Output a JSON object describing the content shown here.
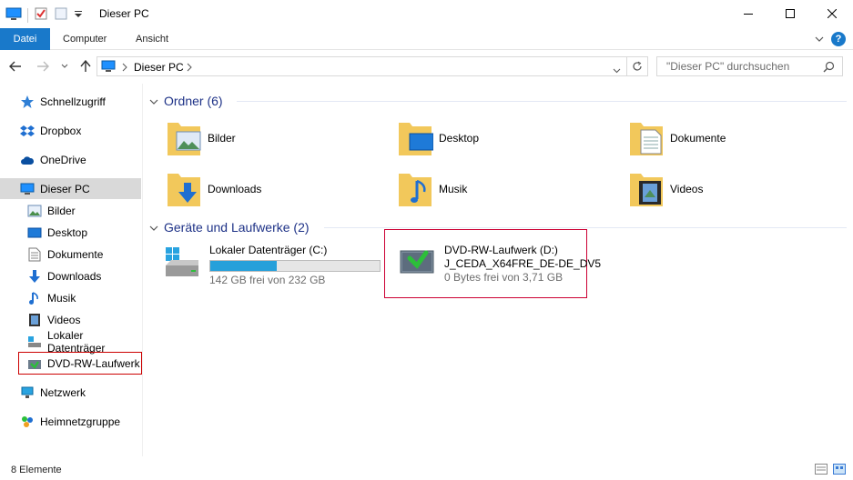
{
  "window": {
    "title": "Dieser PC"
  },
  "ribbon": {
    "tabs": [
      "Datei",
      "Computer",
      "Ansicht"
    ],
    "help": "?"
  },
  "address": {
    "path_item": "Dieser PC",
    "search_placeholder": "\"Dieser PC\" durchsuchen"
  },
  "sidebar": {
    "items": [
      {
        "label": "Schnellzugriff",
        "icon": "star-icon"
      },
      {
        "label": "Dropbox",
        "icon": "dropbox-icon"
      },
      {
        "label": "OneDrive",
        "icon": "cloud-icon"
      },
      {
        "label": "Dieser PC",
        "icon": "computer-icon"
      },
      {
        "label": "Bilder",
        "icon": "pictures-icon"
      },
      {
        "label": "Desktop",
        "icon": "desktop-icon"
      },
      {
        "label": "Dokumente",
        "icon": "documents-icon"
      },
      {
        "label": "Downloads",
        "icon": "download-icon"
      },
      {
        "label": "Musik",
        "icon": "music-icon"
      },
      {
        "label": "Videos",
        "icon": "video-icon"
      },
      {
        "label": "Lokaler Datenträger",
        "icon": "drive-icon"
      },
      {
        "label": "DVD-RW-Laufwerk",
        "icon": "dvd-icon"
      },
      {
        "label": "Netzwerk",
        "icon": "network-icon"
      },
      {
        "label": "Heimnetzgruppe",
        "icon": "homegroup-icon"
      }
    ]
  },
  "main": {
    "folders_header": "Ordner (6)",
    "folders": [
      {
        "label": "Bilder",
        "icon": "pictures-icon"
      },
      {
        "label": "Desktop",
        "icon": "desktop-icon"
      },
      {
        "label": "Dokumente",
        "icon": "documents-icon"
      },
      {
        "label": "Downloads",
        "icon": "download-icon"
      },
      {
        "label": "Musik",
        "icon": "music-icon"
      },
      {
        "label": "Videos",
        "icon": "video-icon"
      }
    ],
    "devices_header": "Geräte und Laufwerke (2)",
    "drives": [
      {
        "name": "Lokaler Datenträger (C:)",
        "free": "142 GB frei von 232 GB",
        "used_fraction": 0.39
      },
      {
        "name": "DVD-RW-Laufwerk (D:)",
        "volume": "J_CEDA_X64FRE_DE-DE_DV5",
        "free": "0 Bytes frei von 3,71 GB"
      }
    ]
  },
  "status": {
    "items": "8 Elemente"
  },
  "colors": {
    "accent": "#1979ca",
    "group_header": "#1e3287",
    "highlight_box": "#cc0033",
    "capacity_fill": "#26a0da"
  }
}
